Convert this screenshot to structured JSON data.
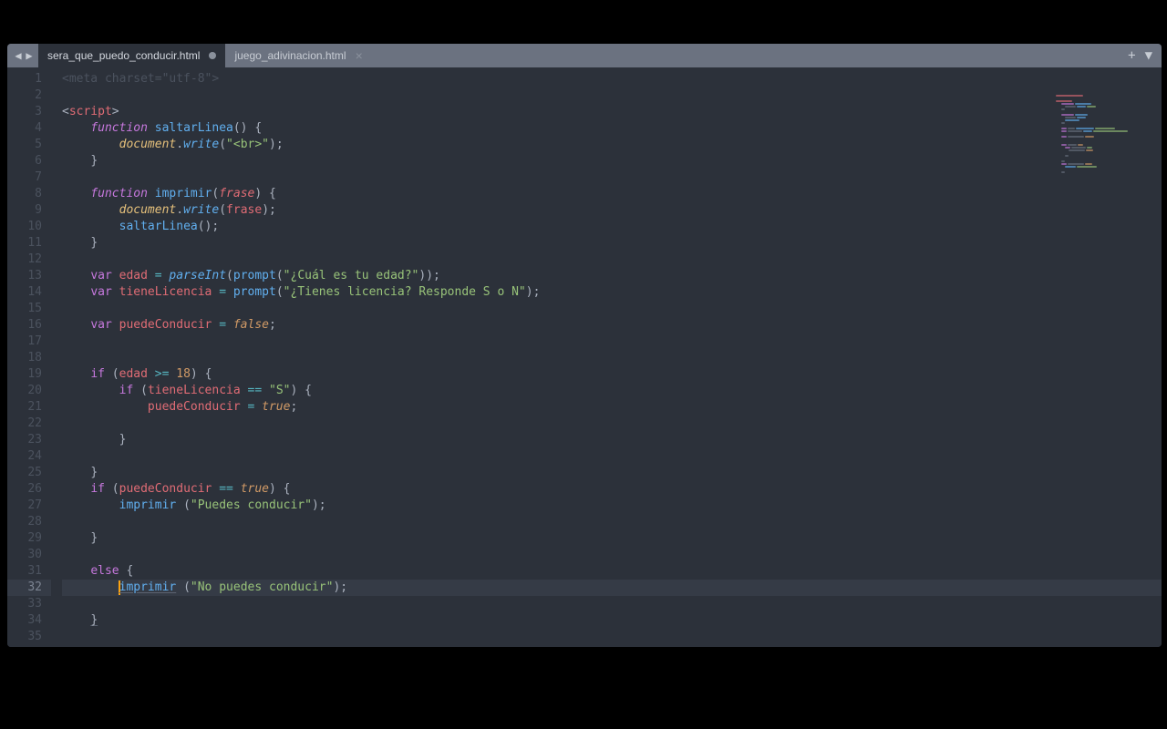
{
  "tabs": {
    "active": "sera_que_puedo_conducir.html",
    "inactive": "juego_adivinacion.html"
  },
  "gutter": {
    "start": 1,
    "end": 35,
    "active": 32
  },
  "code": {
    "l1": "<meta charset=\"utf-8\">",
    "l3_open": "<",
    "l3_tag": "script",
    "l3_close": ">",
    "l4_kw": "function",
    "l4_name": "saltarLinea",
    "l5_obj": "document",
    "l5_method": "write",
    "l5_str": "\"<br>\"",
    "l8_kw": "function",
    "l8_name": "imprimir",
    "l8_param": "frase",
    "l9_obj": "document",
    "l9_method": "write",
    "l9_arg": "frase",
    "l10_call": "saltarLinea",
    "l13_var": "var",
    "l13_name": "edad",
    "l13_parse": "parseInt",
    "l13_prompt": "prompt",
    "l13_str": "\"¿Cuál es tu edad?\"",
    "l14_var": "var",
    "l14_name": "tieneLicencia",
    "l14_prompt": "prompt",
    "l14_str": "\"¿Tienes licencia? Responde S o N\"",
    "l16_var": "var",
    "l16_name": "puedeConducir",
    "l16_false": "false",
    "l19_if": "if",
    "l19_edad": "edad",
    "l19_op": ">=",
    "l19_num": "18",
    "l20_if": "if",
    "l20_var": "tieneLicencia",
    "l20_op": "==",
    "l20_str": "\"S\"",
    "l21_var": "puedeConducir",
    "l21_true": "true",
    "l26_if": "if",
    "l26_var": "puedeConducir",
    "l26_op": "==",
    "l26_true": "true",
    "l27_call": "imprimir",
    "l27_str": "\"Puedes conducir\"",
    "l31_else": "else",
    "l32_call": "imprimir",
    "l32_str": "\"No puedes conducir\""
  }
}
